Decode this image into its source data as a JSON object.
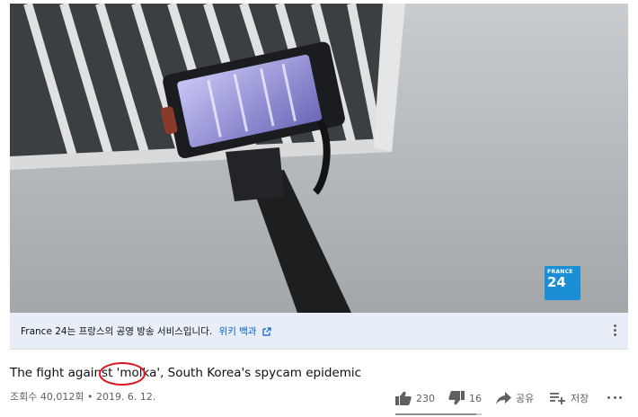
{
  "video": {
    "logo_line1": "FRANCE",
    "logo_line2": "24"
  },
  "info_panel": {
    "text": "France 24는 프랑스의 공영 방송 서비스입니다.",
    "link": "위키 백과"
  },
  "title": "The fight against 'molka', South Korea's spycam epidemic",
  "meta": "조회수 40,012회 • 2019. 6. 12.",
  "actions": {
    "likes": "230",
    "dislikes": "16",
    "share": "공유",
    "save": "저장",
    "like_ratio": 0.935
  },
  "colors": {
    "link": "#065fd4",
    "annotation": "#e0141e",
    "logo": "#1a8fd6"
  }
}
